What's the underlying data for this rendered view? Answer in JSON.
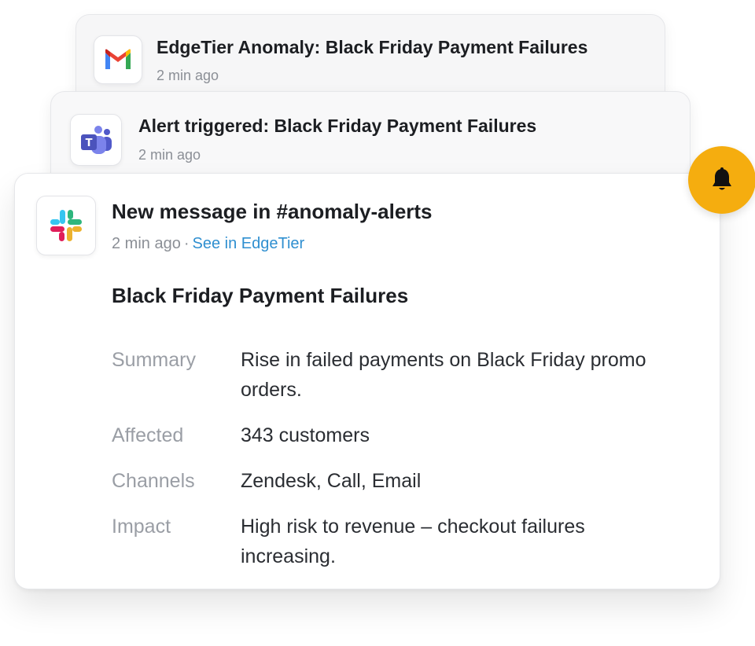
{
  "notifications": [
    {
      "app_icon": "gmail-icon",
      "title": "EdgeTier Anomaly: Black Friday Payment Failures",
      "time": "2 min ago"
    },
    {
      "app_icon": "teams-icon",
      "title": "Alert triggered: Black Friday Payment Failures",
      "time": "2 min ago"
    }
  ],
  "message": {
    "app_icon": "slack-icon",
    "title": "New message in #anomaly-alerts",
    "time": "2 min ago",
    "separator": "·",
    "link_label": "See in EdgeTier",
    "heading": "Black Friday Payment Failures",
    "details": [
      {
        "label": "Summary",
        "value": "Rise in failed payments on Black Friday promo orders."
      },
      {
        "label": "Affected",
        "value": "343 customers"
      },
      {
        "label": "Channels",
        "value": "Zendesk, Call, Email"
      },
      {
        "label": "Impact",
        "value": "High risk to revenue – checkout failures increasing."
      }
    ]
  },
  "bell_button": {
    "icon": "bell-icon",
    "color": "#f5ad0f"
  },
  "colors": {
    "link": "#2f8fd0",
    "muted": "#8b8f96",
    "label": "#9a9ea5"
  }
}
